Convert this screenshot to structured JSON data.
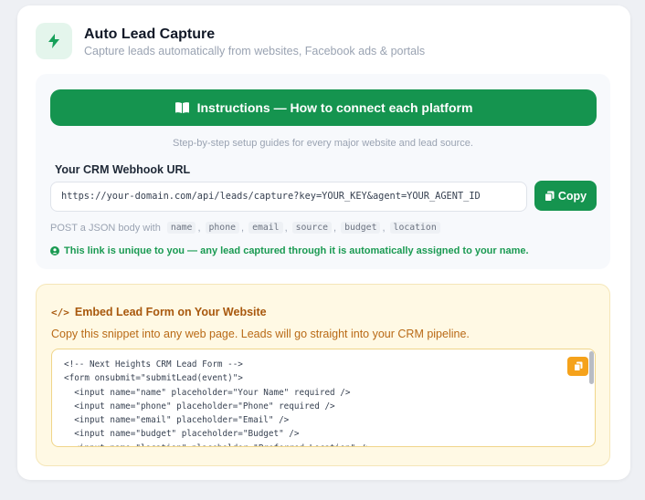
{
  "header": {
    "title": "Auto Lead Capture",
    "subtitle": "Capture leads automatically from websites, Facebook ads & portals",
    "icon": "lightning-icon"
  },
  "instructions": {
    "button_label": "Instructions — How to connect each platform",
    "button_icon": "book-icon",
    "subtext": "Step-by-step setup guides for every major website and lead source."
  },
  "webhook": {
    "label": "Your CRM Webhook URL",
    "url": "https://your-domain.com/api/leads/capture?key=YOUR_KEY&agent=YOUR_AGENT_ID",
    "copy_label": "Copy",
    "post_prefix": "POST a JSON body with",
    "fields": [
      "name",
      "phone",
      "email",
      "source",
      "budget",
      "location"
    ],
    "unique_note": "This link is unique to you — any lead captured through it is automatically assigned to your name."
  },
  "embed": {
    "title": "Embed Lead Form on Your Website",
    "title_icon": "</>",
    "description": "Copy this snippet into any web page. Leads will go straight into your CRM pipeline.",
    "code": "<!-- Next Heights CRM Lead Form -->\n<form onsubmit=\"submitLead(event)\">\n  <input name=\"name\" placeholder=\"Your Name\" required />\n  <input name=\"phone\" placeholder=\"Phone\" required />\n  <input name=\"email\" placeholder=\"Email\" />\n  <input name=\"budget\" placeholder=\"Budget\" />\n  <input name=\"location\" placeholder=\"Preferred Location\" />"
  },
  "colors": {
    "brand_green": "#15944f",
    "accent_orange": "#f5a21b",
    "embed_bg": "#fff9e4"
  }
}
